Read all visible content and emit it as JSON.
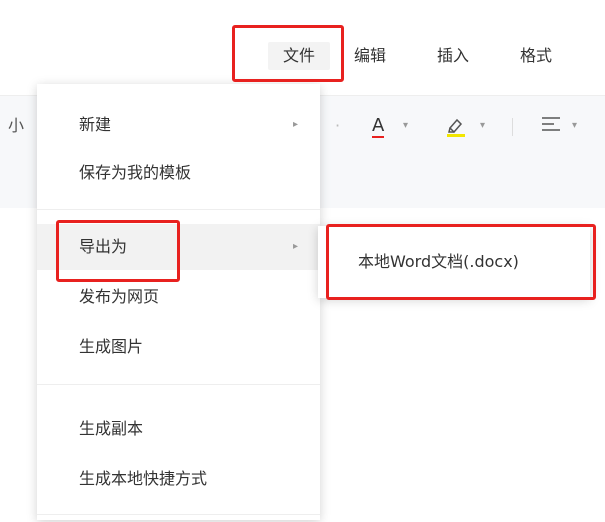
{
  "menubar": {
    "file": "文件",
    "edit": "编辑",
    "insert": "插入",
    "format": "格式"
  },
  "toolbar": {
    "font_size_fragment": "小",
    "font_color_letter": "A",
    "highlight_icon": "highlighter-icon",
    "align_icon": "align-icon",
    "dropdown_caret": "▾",
    "highlight_underline_color": "#f2e600",
    "font_color_underline_color": "#e8211f"
  },
  "dropdown": {
    "items": [
      {
        "label": "新建",
        "has_submenu": true
      },
      {
        "label": "保存为我的模板",
        "has_submenu": false
      },
      {
        "label": "导出为",
        "has_submenu": true
      },
      {
        "label": "发布为网页",
        "has_submenu": false
      },
      {
        "label": "生成图片",
        "has_submenu": false
      },
      {
        "label": "生成副本",
        "has_submenu": false
      },
      {
        "label": "生成本地快捷方式",
        "has_submenu": false
      }
    ],
    "submenu_arrow": "▸"
  },
  "submenu": {
    "items": [
      {
        "label": "本地Word文档(.docx)"
      }
    ]
  },
  "colors": {
    "highlight_box": "#e8211f"
  }
}
